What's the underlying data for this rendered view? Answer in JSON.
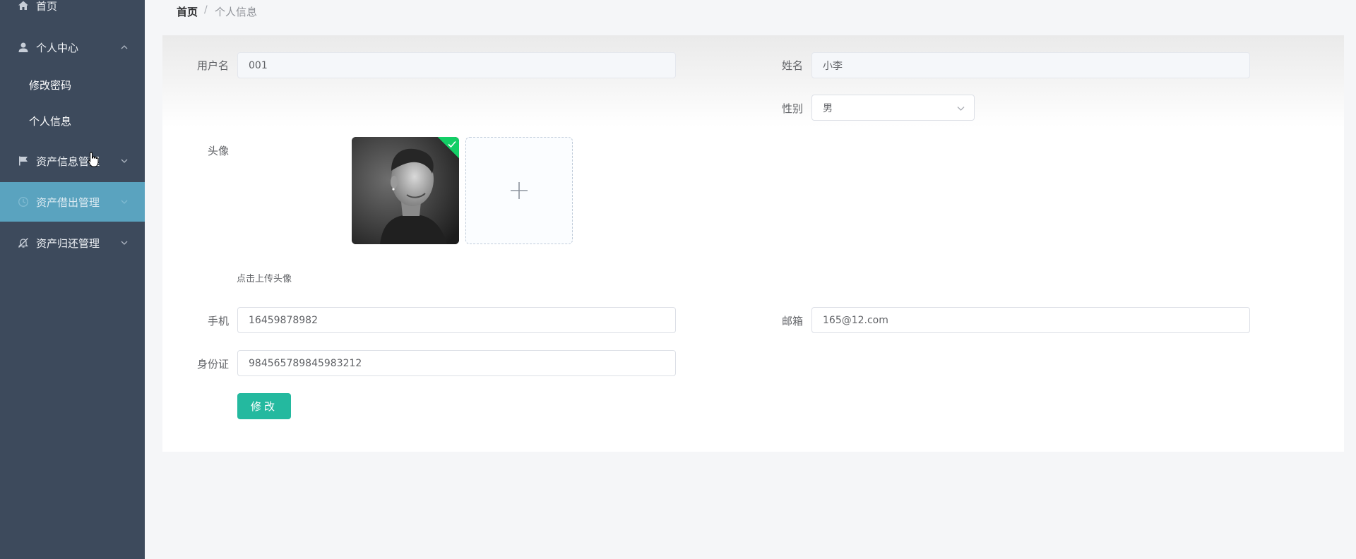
{
  "sidebar": {
    "items": [
      {
        "label": "首页",
        "icon": "home-icon"
      },
      {
        "label": "个人中心",
        "icon": "user-icon",
        "expanded": true,
        "children": [
          {
            "label": "修改密码"
          },
          {
            "label": "个人信息"
          }
        ]
      },
      {
        "label": "资产信息管理",
        "icon": "flag-icon"
      },
      {
        "label": "资产借出管理",
        "icon": "clock-icon",
        "active": true
      },
      {
        "label": "资产归还管理",
        "icon": "bell-off-icon"
      }
    ]
  },
  "breadcrumb": {
    "home": "首页",
    "separator": "/",
    "current": "个人信息"
  },
  "form": {
    "username": {
      "label": "用户名",
      "value": "001"
    },
    "name": {
      "label": "姓名",
      "value": "小李"
    },
    "gender": {
      "label": "性别",
      "value": "男"
    },
    "avatar": {
      "label": "头像",
      "tip": "点击上传头像"
    },
    "phone": {
      "label": "手机",
      "value": "16459878982"
    },
    "email": {
      "label": "邮箱",
      "value": "165@12.com"
    },
    "id_card": {
      "label": "身份证",
      "value": "984565789845983212"
    },
    "submit_label": "修改"
  },
  "colors": {
    "sidebar_bg": "#3d4a5c",
    "active_menu": "#5aa3bf",
    "primary_button": "#24b99f",
    "success_badge": "#13ce66"
  }
}
